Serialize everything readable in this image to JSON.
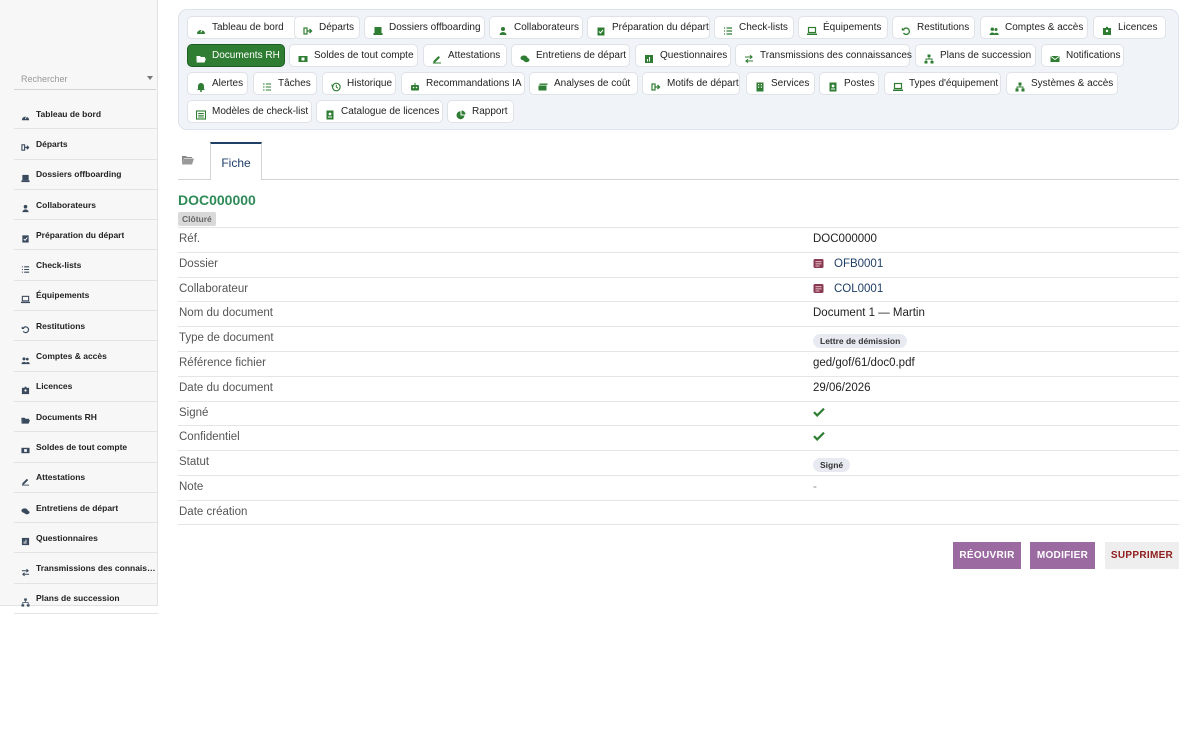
{
  "sidebar": {
    "search_placeholder": "Rechercher",
    "items": [
      {
        "label": "Tableau de bord",
        "icon": "dashboard-icon"
      },
      {
        "label": "Départs",
        "icon": "sign-out-icon"
      },
      {
        "label": "Dossiers offboarding",
        "icon": "folder-user-icon"
      },
      {
        "label": "Collaborateurs",
        "icon": "user-icon"
      },
      {
        "label": "Préparation du départ",
        "icon": "clipboard-check-icon"
      },
      {
        "label": "Check-lists",
        "icon": "list-icon"
      },
      {
        "label": "Équipements",
        "icon": "laptop-icon"
      },
      {
        "label": "Restitutions",
        "icon": "undo-icon"
      },
      {
        "label": "Comptes & accès",
        "icon": "users-icon"
      },
      {
        "label": "Licences",
        "icon": "id-badge-icon"
      },
      {
        "label": "Documents RH",
        "icon": "folder-open-icon"
      },
      {
        "label": "Soldes de tout compte",
        "icon": "money-icon"
      },
      {
        "label": "Attestations",
        "icon": "signature-icon"
      },
      {
        "label": "Entretiens de départ",
        "icon": "comments-icon"
      },
      {
        "label": "Questionnaires",
        "icon": "poll-icon"
      },
      {
        "label": "Transmissions des connaissances",
        "icon": "exchange-icon"
      },
      {
        "label": "Plans de succession",
        "icon": "sitemap-icon"
      }
    ]
  },
  "topnav": {
    "buttons": [
      {
        "label": "Tableau de bord",
        "icon": "dashboard-icon"
      },
      {
        "label": "Départs",
        "icon": "sign-out-icon"
      },
      {
        "label": "Dossiers offboarding",
        "icon": "folder-user-icon"
      },
      {
        "label": "Collaborateurs",
        "icon": "user-icon"
      },
      {
        "label": "Préparation du départ",
        "icon": "clipboard-check-icon"
      },
      {
        "label": "Check-lists",
        "icon": "list-icon"
      },
      {
        "label": "Équipements",
        "icon": "laptop-icon"
      },
      {
        "label": "Restitutions",
        "icon": "undo-icon"
      },
      {
        "label": "Comptes & accès",
        "icon": "users-icon"
      },
      {
        "label": "Licences",
        "icon": "id-badge-icon"
      },
      {
        "label": "Documents RH",
        "icon": "folder-open-icon",
        "active": true
      },
      {
        "label": "Soldes de tout compte",
        "icon": "money-icon"
      },
      {
        "label": "Attestations",
        "icon": "signature-icon"
      },
      {
        "label": "Entretiens de départ",
        "icon": "comments-icon"
      },
      {
        "label": "Questionnaires",
        "icon": "poll-icon"
      },
      {
        "label": "Transmissions des connaissances",
        "icon": "exchange-icon"
      },
      {
        "label": "Plans de succession",
        "icon": "sitemap-icon"
      },
      {
        "label": "Notifications",
        "icon": "envelope-icon"
      },
      {
        "label": "Alertes",
        "icon": "bell-icon"
      },
      {
        "label": "Tâches",
        "icon": "tasks-icon"
      },
      {
        "label": "Historique",
        "icon": "history-icon"
      },
      {
        "label": "Recommandations IA",
        "icon": "robot-icon"
      },
      {
        "label": "Analyses de coût",
        "icon": "money-bills-icon"
      },
      {
        "label": "Motifs de départ",
        "icon": "sign-out-icon"
      },
      {
        "label": "Services",
        "icon": "building-icon"
      },
      {
        "label": "Postes",
        "icon": "id-card-icon"
      },
      {
        "label": "Types d'équipement",
        "icon": "laptop-icon"
      },
      {
        "label": "Systèmes & accès",
        "icon": "network-icon"
      },
      {
        "label": "Modèles de check-list",
        "icon": "list-alt-icon"
      },
      {
        "label": "Catalogue de licences",
        "icon": "id-card-icon"
      },
      {
        "label": "Rapport",
        "icon": "chart-pie-icon"
      }
    ]
  },
  "tabs": {
    "icon": "folder-open-icon",
    "active_label": "Fiche"
  },
  "record": {
    "title": "DOC000000",
    "status_badge": "Clôturé",
    "fields": [
      {
        "label": "Réf.",
        "value": "DOC000000",
        "kind": "text"
      },
      {
        "label": "Dossier",
        "value": "OFB0001",
        "kind": "link",
        "icon": "record-icon"
      },
      {
        "label": "Collaborateur",
        "value": "COL0001",
        "kind": "link",
        "icon": "record-icon"
      },
      {
        "label": "Nom du document",
        "value": "Document 1 — Martin",
        "kind": "text"
      },
      {
        "label": "Type de document",
        "value": "Lettre de démission",
        "kind": "tag"
      },
      {
        "label": "Référence fichier",
        "value": "ged/gof/61/doc0.pdf",
        "kind": "text"
      },
      {
        "label": "Date du document",
        "value": "29/06/2026",
        "kind": "text"
      },
      {
        "label": "Signé",
        "value": "",
        "kind": "check"
      },
      {
        "label": "Confidentiel",
        "value": "",
        "kind": "check"
      },
      {
        "label": "Statut",
        "value": "Signé",
        "kind": "tag"
      },
      {
        "label": "Note",
        "value": "-",
        "kind": "dash"
      },
      {
        "label": "Date création",
        "value": "",
        "kind": "text"
      }
    ]
  },
  "actions": {
    "reopen_label": "RÉOUVRIR",
    "edit_label": "MODIFIER",
    "delete_label": "SUPPRIMER"
  },
  "colors": {
    "accent_green": "#2e7d32",
    "title_green": "#2e8b57",
    "action_purple": "#9b6aa1",
    "delete_red": "#8e1d1d",
    "link_blue": "#1f3f66"
  }
}
